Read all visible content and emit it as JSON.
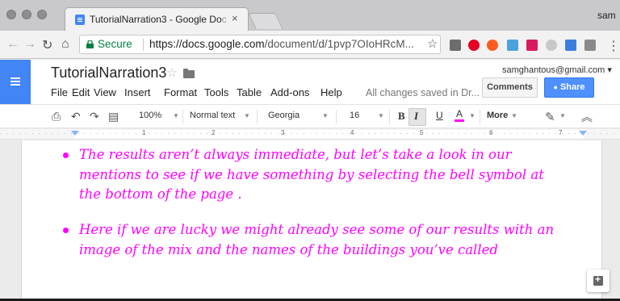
{
  "browser": {
    "tab_title": "TutorialNarration3 - Google Do",
    "tab_title_fade": "c",
    "tab_close": "×",
    "profile_name": "sam",
    "secure_label": "Secure",
    "url_host": "https://docs.google.com",
    "url_path": "/document/d/1pvp7OIoHRcM...",
    "star": "☆"
  },
  "docs": {
    "title": "TutorialNarration3",
    "title_star": "☆",
    "account_email": "samghantous@gmail.com ▾",
    "menu": [
      "File",
      "Edit",
      "View",
      "Insert",
      "Format",
      "Tools",
      "Table",
      "Add-ons",
      "Help"
    ],
    "saved_status": "All changes saved in Dr...",
    "comments_label": "Comments",
    "share_label": "Share",
    "share_lock": "🔒"
  },
  "format_toolbar": {
    "zoom": "100%",
    "style": "Normal text",
    "font": "Georgia",
    "size": "16",
    "bold": "B",
    "italic": "I",
    "underline": "U",
    "text_color": "A",
    "more": "More",
    "collapse": "≈"
  },
  "ruler": {
    "numbers": [
      "1",
      "2",
      "3",
      "4",
      "5",
      "6",
      "7"
    ]
  },
  "document": {
    "text_color": "#ff00ff",
    "bullets": [
      "The results aren’t always immediate, but let’s take a look in our mentions to see if we have something by selecting the bell symbol at the bottom of the page .",
      "Here if we are lucky we might already see some of our results with an image of the mix and the names of the buildings you’ve called"
    ]
  },
  "colors": {
    "docs_blue": "#4285f4",
    "share_blue": "#4d90fe",
    "secure_green": "#0b8043",
    "text_magenta": "#ff00ff"
  }
}
